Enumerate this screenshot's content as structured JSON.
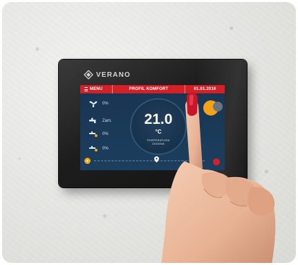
{
  "brand": {
    "name": "VERANO"
  },
  "screen": {
    "topbar": {
      "menu_label": "MENU",
      "profile_label": "PROFIL KOMFORT",
      "date": "01.01.2016"
    },
    "rows": [
      {
        "icon": "fan-icon",
        "value": "0%"
      },
      {
        "icon": "tap-icon",
        "value": "Zam."
      },
      {
        "icon": "heater-icon",
        "value": "0%"
      },
      {
        "icon": "valve-icon",
        "value": "0%"
      }
    ],
    "temperature": {
      "value": "21.0",
      "unit": "°C",
      "label_line1": "TEMPERATURA",
      "label_line2": "ZADANA"
    }
  },
  "colors": {
    "accent_red": "#d62027",
    "accent_orange": "#f3a21a",
    "screen_bg": "#183552"
  }
}
